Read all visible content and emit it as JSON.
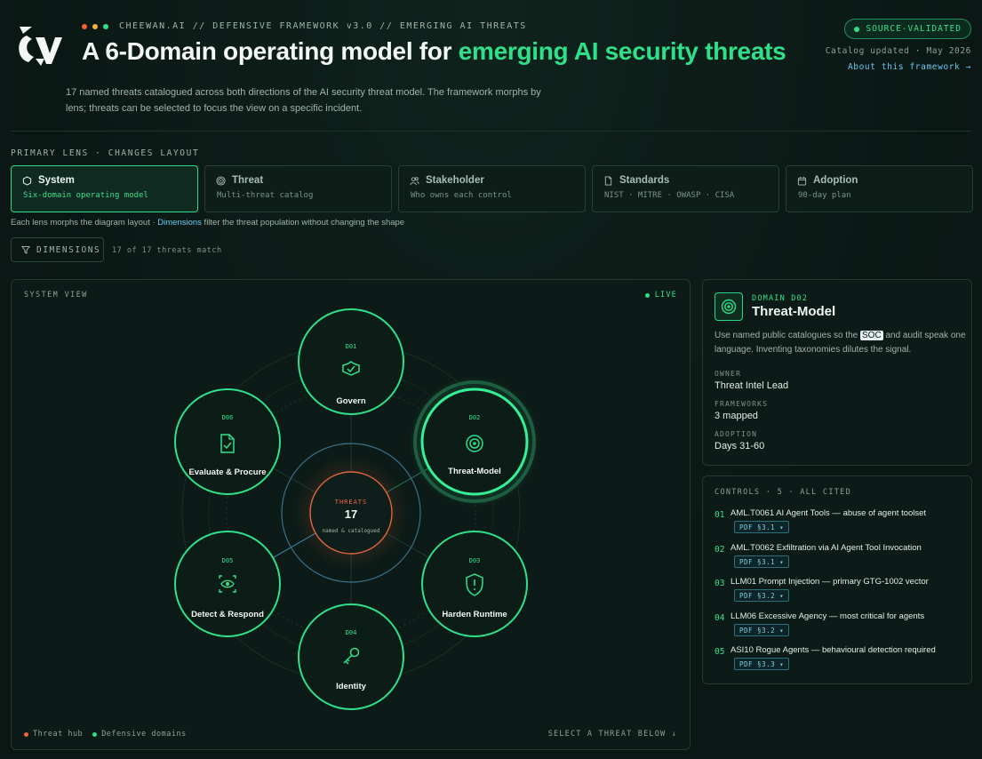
{
  "header": {
    "logo_text": "CV",
    "breadcrumb": "CHEEWAN.AI // DEFENSIVE FRAMEWORK v3.0 // EMERGING AI THREATS",
    "title_main": "A 6-Domain operating model for ",
    "title_highlight": "emerging AI security threats",
    "description": "17 named threats catalogued across both directions of the AI security threat model. The framework morphs by lens; threats can be selected to focus the view on a specific incident.",
    "badge": "SOURCE-VALIDATED",
    "updated": "Catalog updated · May 2026",
    "about_link": "About this framework →",
    "dot_colors": [
      "#f0633a",
      "#f3b23a",
      "#2fe08a"
    ]
  },
  "lens": {
    "label": "PRIMARY LENS · CHANGES LAYOUT",
    "items": [
      {
        "title": "System",
        "subtitle": "Six-domain operating model",
        "icon": "hexagon-icon",
        "active": true
      },
      {
        "title": "Threat",
        "subtitle": "Multi-threat catalog",
        "icon": "target-icon",
        "active": false
      },
      {
        "title": "Stakeholder",
        "subtitle": "Who owns each control",
        "icon": "users-icon",
        "active": false
      },
      {
        "title": "Standards",
        "subtitle": "NIST · MITRE · OWASP · CISA",
        "icon": "document-icon",
        "active": false
      },
      {
        "title": "Adoption",
        "subtitle": "90-day plan",
        "icon": "calendar-icon",
        "active": false
      }
    ],
    "hint_pre": "Each lens morphs the diagram layout · ",
    "hint_link": "Dimensions",
    "hint_post": " filter the threat population without changing the shape",
    "dimensions_label": "DIMENSIONS",
    "match_text": "17 of 17 threats match"
  },
  "system_view": {
    "label": "SYSTEM VIEW",
    "live": "LIVE",
    "hub": {
      "label": "THREATS",
      "count": "17",
      "sub": "named & catalogued"
    },
    "domains": [
      {
        "code": "D01",
        "name": "Govern",
        "icon": "shield-check-icon"
      },
      {
        "code": "D02",
        "name": "Threat-Model",
        "icon": "target-icon",
        "selected": true
      },
      {
        "code": "D03",
        "name": "Harden Runtime",
        "icon": "shield-alert-icon"
      },
      {
        "code": "D04",
        "name": "Identity",
        "icon": "key-icon"
      },
      {
        "code": "D05",
        "name": "Detect & Respond",
        "icon": "eye-scan-icon"
      },
      {
        "code": "D06",
        "name": "Evaluate & Procure",
        "icon": "file-check-icon"
      }
    ],
    "legend_hub": "Threat hub",
    "legend_domains": "Defensive domains",
    "select_hint": "SELECT A THREAT BELOW ↓",
    "colors": {
      "accent": "#2fe08a",
      "hub": "#f0633a"
    }
  },
  "detail": {
    "code": "DOMAIN D02",
    "name": "Threat-Model",
    "desc_pre": "Use named public catalogues so the ",
    "desc_kw": "SOC",
    "desc_post": " and audit speak one language. Inventing taxonomies dilutes the signal.",
    "owner_label": "OWNER",
    "owner": "Threat Intel Lead",
    "frameworks_label": "FRAMEWORKS",
    "frameworks": "3 mapped",
    "adoption_label": "ADOPTION",
    "adoption": "Days 31-60"
  },
  "controls": {
    "header": "CONTROLS · 5 · ALL CITED",
    "items": [
      {
        "num": "01",
        "text": "AML.T0061 AI Agent Tools — abuse of agent toolset",
        "pill": "PDF §3.1 ▾"
      },
      {
        "num": "02",
        "text": "AML.T0062 Exfiltration via AI Agent Tool Invocation",
        "pill": "PDF §3.1 ▾"
      },
      {
        "num": "03",
        "text": "LLM01 Prompt Injection — primary GTG-1002 vector",
        "pill": "PDF §3.2 ▾"
      },
      {
        "num": "04",
        "text": "LLM06 Excessive Agency — most critical for agents",
        "pill": "PDF §3.2 ▾"
      },
      {
        "num": "05",
        "text": "ASI10 Rogue Agents — behavioural detection required",
        "pill": "PDF §3.3 ▾"
      }
    ]
  }
}
